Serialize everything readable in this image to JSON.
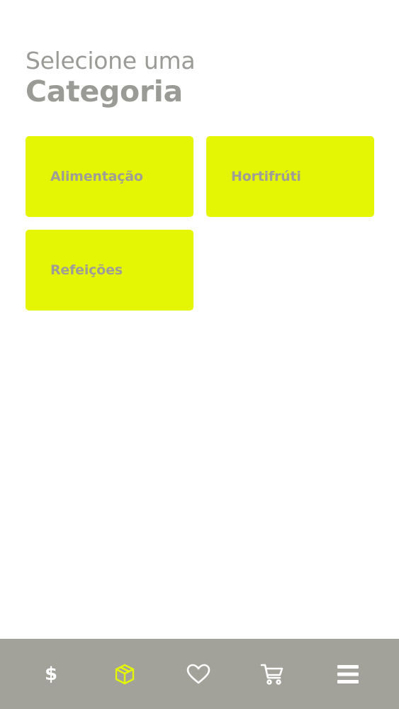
{
  "header": {
    "subtitle": "Selecione uma",
    "title": "Categoria"
  },
  "categories": [
    {
      "label": "Alimentação"
    },
    {
      "label": "Hortifrúti"
    },
    {
      "label": "Refeições"
    }
  ],
  "bottom_nav": {
    "items": [
      {
        "icon": "dollar-icon",
        "glyph": "$",
        "active": false
      },
      {
        "icon": "box-icon",
        "active": true
      },
      {
        "icon": "heart-icon",
        "active": false
      },
      {
        "icon": "cart-icon",
        "active": false
      },
      {
        "icon": "menu-icon",
        "active": false
      }
    ]
  },
  "colors": {
    "accent": "#e5f605",
    "text_gray": "#9a9a96",
    "nav_background": "#a2a29a",
    "nav_icon": "#ffffff",
    "nav_icon_active": "#e5f605"
  }
}
